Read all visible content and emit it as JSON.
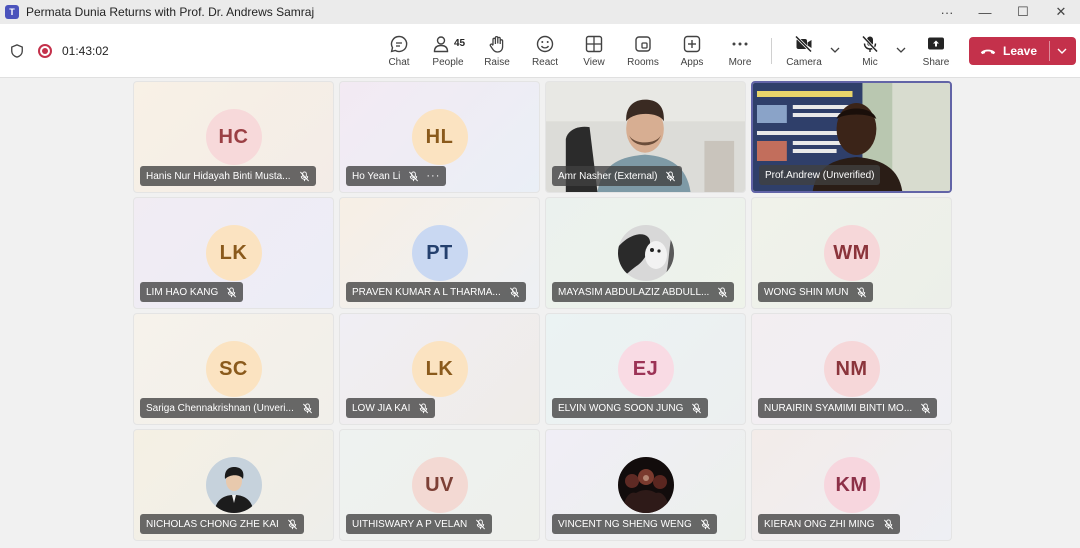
{
  "window": {
    "title": "Permata Dunia Returns with Prof. Dr. Andrews Samraj",
    "logo": "T"
  },
  "meeting": {
    "timer": "01:43:02"
  },
  "toolbar": {
    "chat": "Chat",
    "people": "People",
    "people_count": "45",
    "raise": "Raise",
    "react": "React",
    "view": "View",
    "rooms": "Rooms",
    "apps": "Apps",
    "more": "More",
    "camera": "Camera",
    "mic": "Mic",
    "share": "Share",
    "leave": "Leave"
  },
  "colors": {
    "accent": "#6264a7",
    "leave": "#c4314b"
  },
  "participants": [
    {
      "name": "Hanis Nur Hidayah Binti Musta...",
      "initials": "HC",
      "kind": "initials",
      "muted": true
    },
    {
      "name": "Ho Yean Li",
      "initials": "HL",
      "kind": "initials",
      "muted": true,
      "more": "···"
    },
    {
      "name": "Amr Nasher (External)",
      "kind": "video",
      "muted": true
    },
    {
      "name": "Prof.Andrew (Unverified)",
      "kind": "video",
      "muted": false,
      "active": true
    },
    {
      "name": "LIM HAO KANG",
      "initials": "LK",
      "kind": "initials",
      "muted": true
    },
    {
      "name": "PRAVEN KUMAR A L THARMA...",
      "initials": "PT",
      "kind": "initials",
      "muted": true
    },
    {
      "name": "MAYASIM ABDULAZIZ ABDULL...",
      "kind": "photo",
      "muted": true
    },
    {
      "name": "WONG SHIN MUN",
      "initials": "WM",
      "kind": "initials",
      "muted": true
    },
    {
      "name": "Sariga Chennakrishnan (Unveri...",
      "initials": "SC",
      "kind": "initials",
      "muted": true
    },
    {
      "name": "LOW JIA KAI",
      "initials": "LK",
      "kind": "initials",
      "muted": true
    },
    {
      "name": "ELVIN WONG SOON JUNG",
      "initials": "EJ",
      "kind": "initials",
      "muted": true
    },
    {
      "name": "NURAIRIN SYAMIMI BINTI MO...",
      "initials": "NM",
      "kind": "initials",
      "muted": true
    },
    {
      "name": "NICHOLAS CHONG ZHE KAI",
      "kind": "photo",
      "muted": true
    },
    {
      "name": "UITHISWARY A P VELAN",
      "initials": "UV",
      "kind": "initials",
      "muted": true
    },
    {
      "name": "VINCENT NG SHENG WENG",
      "kind": "photo",
      "muted": true
    },
    {
      "name": "KIERAN ONG ZHI MING",
      "initials": "KM",
      "kind": "initials",
      "muted": true
    }
  ]
}
